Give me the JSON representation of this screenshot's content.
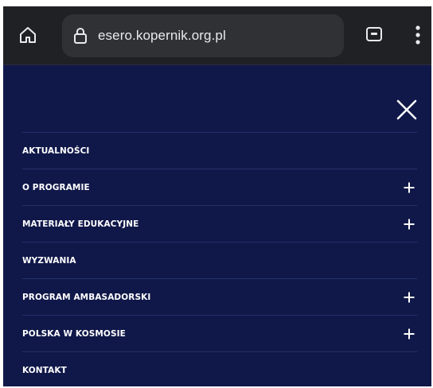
{
  "browser": {
    "url": "esero.kopernik.org.pl",
    "home_icon": "home-icon",
    "lock_icon": "lock-icon",
    "tab_icon": "tab-switcher-icon",
    "menu_icon": "more-vertical-icon"
  },
  "page": {
    "background": "#101849",
    "close_icon": "close-icon",
    "menu": {
      "items": [
        {
          "label": "AKTUALNOŚCI",
          "expandable": false
        },
        {
          "label": "O PROGRAMIE",
          "expandable": true
        },
        {
          "label": "MATERIAŁY EDUKACYJNE",
          "expandable": true
        },
        {
          "label": "WYZWANIA",
          "expandable": false
        },
        {
          "label": "PROGRAM AMBASADORSKI",
          "expandable": true
        },
        {
          "label": "POLSKA W KOSMOSIE",
          "expandable": true
        },
        {
          "label": "KONTAKT",
          "expandable": false
        }
      ]
    }
  }
}
